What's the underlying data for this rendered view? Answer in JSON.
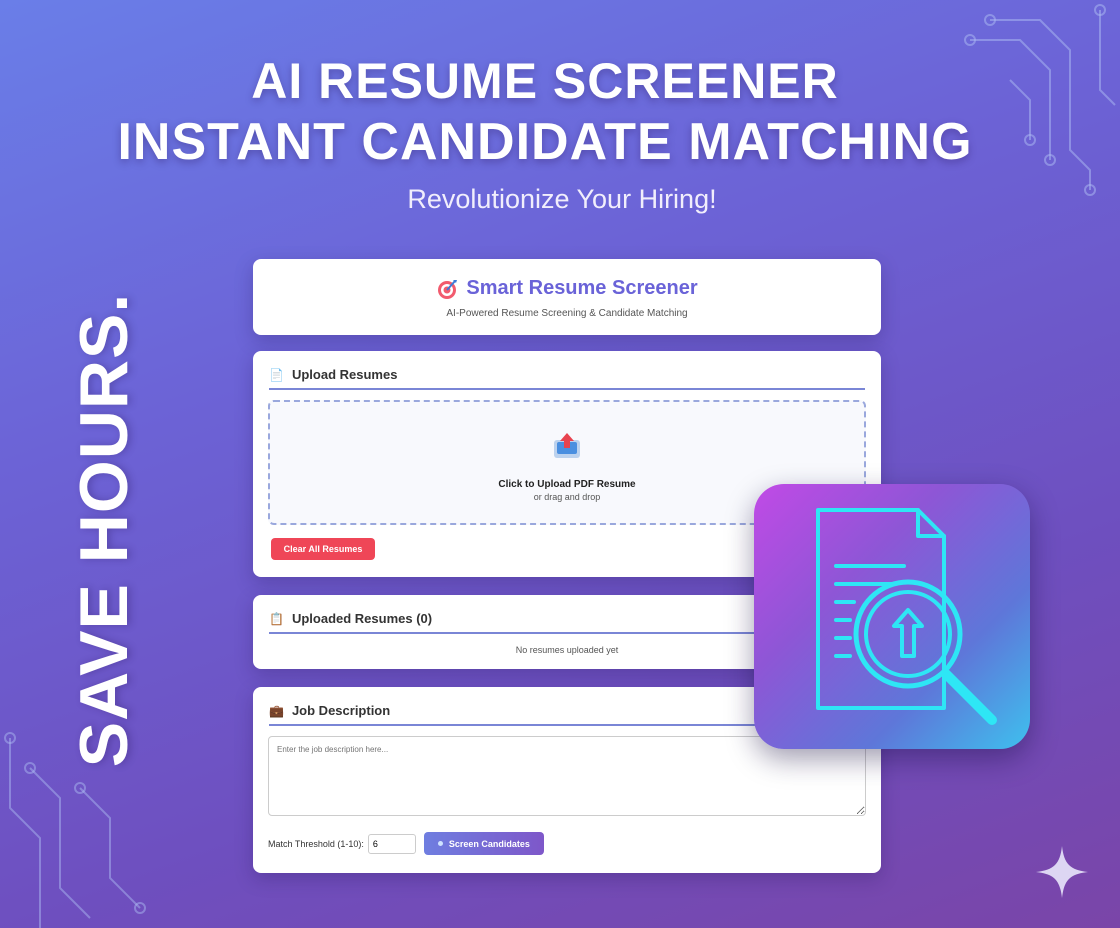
{
  "hero": {
    "line1": "AI RESUME SCREENER",
    "line2": "INSTANT CANDIDATE MATCHING",
    "tagline": "Revolutionize Your Hiring!",
    "side_text": "SAVE HOURS."
  },
  "app": {
    "icon": "target-icon",
    "title": "Smart Resume Screener",
    "subtitle": "AI-Powered Resume Screening & Candidate Matching"
  },
  "upload": {
    "icon": "document-icon",
    "title": "Upload Resumes",
    "dropzone_icon": "upload-tray-icon",
    "dropzone_main": "Click to Upload PDF Resume",
    "dropzone_sub": "or drag and drop",
    "clear_label": "Clear All Resumes"
  },
  "uploaded": {
    "icon": "clipboard-icon",
    "title": "Uploaded Resumes (0)",
    "empty_text": "No resumes uploaded yet"
  },
  "job": {
    "icon": "briefcase-icon",
    "title": "Job Description",
    "placeholder": "Enter the job description here...",
    "threshold_label": "Match Threshold (1-10):",
    "threshold_value": "6",
    "screen_label": "Screen Candidates"
  },
  "badge_icon": "document-search-upload-icon",
  "colors": {
    "accent": "#6a63d8",
    "danger": "#ef4657",
    "icon_neon": "#2ee6f5"
  }
}
